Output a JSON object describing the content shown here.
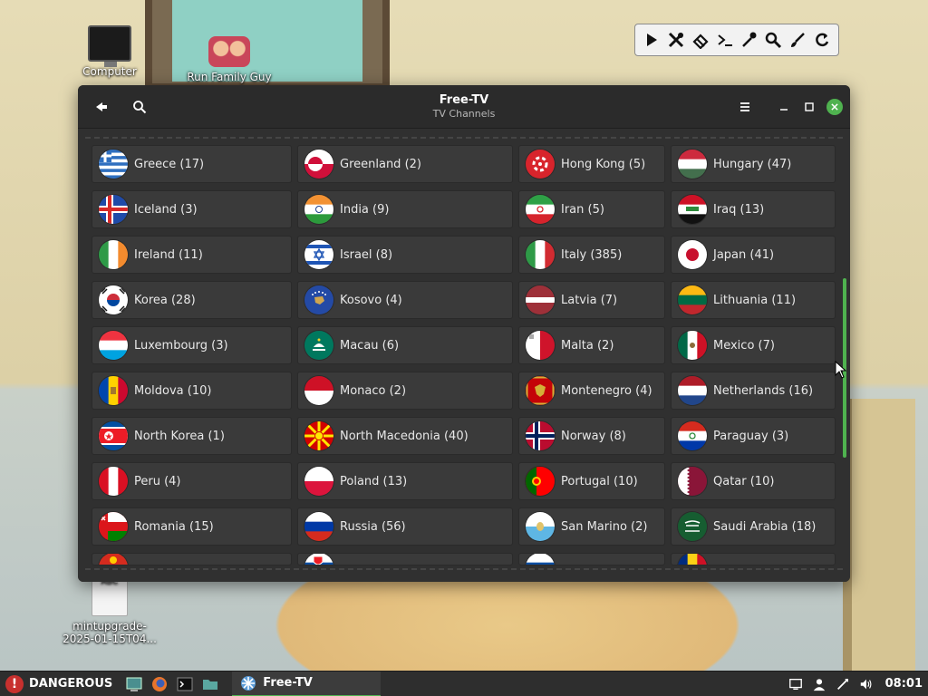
{
  "desktop": {
    "icons": [
      {
        "label": "Computer"
      },
      {
        "label": "Run Family Guy"
      },
      {
        "label": "mintupgrade-2025-01-15T04...",
        "line1": "mintupgrade-",
        "line2": "2025-01-15T04...",
        "thumb_text": "ABC"
      }
    ],
    "floating_toolbar": [
      "play-icon",
      "tools-icon",
      "eraser-icon",
      "terminal-icon",
      "eyedropper-icon",
      "magnifier-icon",
      "brush-icon",
      "refresh-icon"
    ]
  },
  "window": {
    "title": "Free-TV",
    "subtitle": "TV Channels",
    "accent": "#4fb24f"
  },
  "countries": [
    {
      "name": "Greece (17)",
      "flag": "greece"
    },
    {
      "name": "Greenland (2)",
      "flag": "greenland"
    },
    {
      "name": "Hong Kong (5)",
      "flag": "hongkong"
    },
    {
      "name": "Hungary (47)",
      "flag": "hungary"
    },
    {
      "name": "Iceland (3)",
      "flag": "iceland"
    },
    {
      "name": "India (9)",
      "flag": "india"
    },
    {
      "name": "Iran (5)",
      "flag": "iran"
    },
    {
      "name": "Iraq (13)",
      "flag": "iraq"
    },
    {
      "name": "Ireland (11)",
      "flag": "ireland"
    },
    {
      "name": "Israel (8)",
      "flag": "israel"
    },
    {
      "name": "Italy (385)",
      "flag": "italy"
    },
    {
      "name": "Japan (41)",
      "flag": "japan"
    },
    {
      "name": "Korea (28)",
      "flag": "korea"
    },
    {
      "name": "Kosovo (4)",
      "flag": "kosovo"
    },
    {
      "name": "Latvia (7)",
      "flag": "latvia"
    },
    {
      "name": "Lithuania (11)",
      "flag": "lithuania"
    },
    {
      "name": "Luxembourg (3)",
      "flag": "luxembourg"
    },
    {
      "name": "Macau (6)",
      "flag": "macau"
    },
    {
      "name": "Malta (2)",
      "flag": "malta"
    },
    {
      "name": "Mexico (7)",
      "flag": "mexico"
    },
    {
      "name": "Moldova (10)",
      "flag": "moldova"
    },
    {
      "name": "Monaco (2)",
      "flag": "monaco"
    },
    {
      "name": "Montenegro (4)",
      "flag": "montenegro"
    },
    {
      "name": "Netherlands (16)",
      "flag": "netherlands"
    },
    {
      "name": "North Korea (1)",
      "flag": "northkorea"
    },
    {
      "name": "North Macedonia (40)",
      "flag": "macedonia"
    },
    {
      "name": "Norway (8)",
      "flag": "norway"
    },
    {
      "name": "Paraguay (3)",
      "flag": "paraguay"
    },
    {
      "name": "Peru (4)",
      "flag": "peru"
    },
    {
      "name": "Poland (13)",
      "flag": "poland"
    },
    {
      "name": "Portugal (10)",
      "flag": "portugal"
    },
    {
      "name": "Qatar (10)",
      "flag": "qatar"
    },
    {
      "name": "Romania (15)",
      "flag": "oman"
    },
    {
      "name": "Russia (56)",
      "flag": "russia"
    },
    {
      "name": "San Marino (2)",
      "flag": "sanmarino"
    },
    {
      "name": "Saudi Arabia (18)",
      "flag": "saudi"
    },
    {
      "name": "",
      "flag": "partial-red",
      "partial": true
    },
    {
      "name": "",
      "flag": "partial-slovakia",
      "partial": true
    },
    {
      "name": "",
      "flag": "partial-blue",
      "partial": true
    },
    {
      "name": "",
      "flag": "partial-yellow",
      "partial": true
    }
  ],
  "taskbar": {
    "menu_label": "DANGEROUS",
    "task_label": "Free-TV",
    "clock": "08:01"
  }
}
